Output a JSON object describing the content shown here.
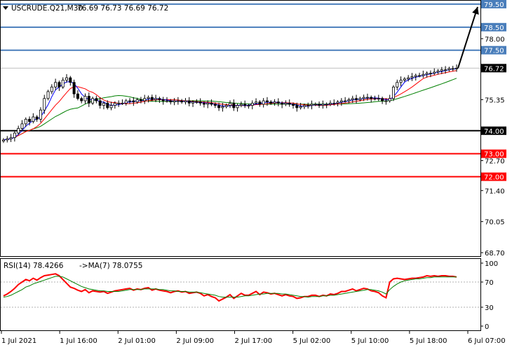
{
  "chart_data": [
    {
      "type": "candlestick",
      "header": {
        "symbol_text": "USCRUDE.Q21,M30",
        "ohlc_text": "76.69 76.73 76.69 76.72",
        "arrow_icon": "triangle-down-icon"
      },
      "y_ticks": [
        79.5,
        78.5,
        78.0,
        77.5,
        76.72,
        75.35,
        74.0,
        73.0,
        72.7,
        72.0,
        71.4,
        70.05,
        68.7
      ],
      "y_tick_labels": [
        "79.50",
        "78.50",
        "78.00",
        "77.50",
        "76.72",
        "75.35",
        "74.00",
        "73.00",
        "72.70",
        "72.00",
        "71.40",
        "70.05",
        "68.70"
      ],
      "ylim": [
        68.55,
        79.65
      ],
      "x_tick_labels": [
        "1 Jul 2021",
        "1 Jul 16:00",
        "2 Jul 01:00",
        "2 Jul 09:00",
        "2 Jul 17:00",
        "5 Jul 02:00",
        "5 Jul 10:00",
        "5 Jul 18:00",
        "6 Jul 07:00"
      ],
      "horizontal_levels": [
        {
          "value": 79.5,
          "label": "79.50",
          "color": "#4a7ebb"
        },
        {
          "value": 78.5,
          "label": "78.50",
          "color": "#4a7ebb"
        },
        {
          "value": 77.5,
          "label": "77.50",
          "color": "#4a7ebb"
        },
        {
          "value": 74.0,
          "label": "74.00",
          "color": "#000000"
        },
        {
          "value": 73.0,
          "label": "73.00",
          "color": "#ff0000"
        },
        {
          "value": 72.0,
          "label": "72.00",
          "color": "#ff0000"
        }
      ],
      "current_price": {
        "value": 76.72,
        "label": "76.72",
        "color": "#000000"
      },
      "projection_arrow": {
        "from": 76.72,
        "to": 79.5,
        "color": "#000000"
      },
      "close_series": [
        73.6,
        73.65,
        73.7,
        73.9,
        74.1,
        74.3,
        74.5,
        74.4,
        74.6,
        74.5,
        74.9,
        75.4,
        75.7,
        75.9,
        76.1,
        75.9,
        76.2,
        76.3,
        76.1,
        75.6,
        75.4,
        75.3,
        75.5,
        75.2,
        75.4,
        75.3,
        75.1,
        75.2,
        75.0,
        75.1,
        75.2,
        75.2,
        75.2,
        75.3,
        75.3,
        75.25,
        75.35,
        75.3,
        75.4,
        75.45,
        75.35,
        75.4,
        75.35,
        75.3,
        75.3,
        75.25,
        75.3,
        75.3,
        75.25,
        75.3,
        75.2,
        75.25,
        75.25,
        75.2,
        75.15,
        75.2,
        75.15,
        75.1,
        75.0,
        75.05,
        75.1,
        75.2,
        75.0,
        75.1,
        75.15,
        75.1,
        75.1,
        75.2,
        75.25,
        75.15,
        75.3,
        75.25,
        75.2,
        75.25,
        75.2,
        75.15,
        75.2,
        75.15,
        75.1,
        75.0,
        75.05,
        75.1,
        75.1,
        75.15,
        75.15,
        75.1,
        75.15,
        75.15,
        75.2,
        75.2,
        75.25,
        75.3,
        75.3,
        75.35,
        75.4,
        75.35,
        75.4,
        75.45,
        75.45,
        75.4,
        75.4,
        75.4,
        75.3,
        75.3,
        75.4,
        75.9,
        76.1,
        76.2,
        76.25,
        76.3,
        76.35,
        76.4,
        76.4,
        76.45,
        76.5,
        76.5,
        76.55,
        76.6,
        76.65,
        76.65,
        76.7,
        76.7,
        76.72
      ],
      "ma_fast_color": "#0000ff",
      "ma_mid_color": "#ff0000",
      "ma_slow_color": "#008000",
      "up_candle_color": "#ffffff",
      "down_candle_color": "#000000"
    },
    {
      "type": "line",
      "header": {
        "rsi_text": "RSI(14) 78.4266",
        "ma_text": "->MA(7) 78.0755"
      },
      "y_ticks": [
        100,
        70,
        30,
        0
      ],
      "y_tick_labels": [
        "100",
        "70",
        "30",
        "0"
      ],
      "levels": [
        70,
        30
      ],
      "ylim": [
        0,
        100
      ],
      "series": [
        {
          "color": "#ff0000",
          "values": [
            48,
            51,
            55,
            60,
            66,
            70,
            74,
            72,
            76,
            73,
            77,
            80,
            81,
            82,
            83,
            80,
            74,
            68,
            62,
            60,
            57,
            55,
            58,
            53,
            56,
            55,
            54,
            55,
            52,
            54,
            56,
            57,
            58,
            59,
            60,
            57,
            59,
            58,
            60,
            61,
            57,
            59,
            57,
            56,
            55,
            53,
            55,
            56,
            54,
            55,
            52,
            53,
            54,
            52,
            48,
            50,
            47,
            45,
            40,
            43,
            46,
            50,
            44,
            48,
            52,
            49,
            49,
            52,
            55,
            50,
            54,
            53,
            51,
            52,
            50,
            48,
            50,
            48,
            47,
            44,
            45,
            47,
            47,
            49,
            49,
            47,
            49,
            48,
            51,
            50,
            52,
            55,
            55,
            57,
            59,
            56,
            58,
            60,
            59,
            56,
            55,
            53,
            48,
            45,
            70,
            75,
            76,
            75,
            74,
            75,
            76,
            76,
            77,
            78,
            80,
            79,
            80,
            79,
            80,
            80,
            79,
            79,
            78
          ]
        },
        {
          "color": "#008000",
          "values": [
            46,
            47,
            49,
            52,
            55,
            58,
            62,
            64,
            67,
            69,
            71,
            73,
            75,
            77,
            79,
            79,
            78,
            75,
            72,
            69,
            66,
            63,
            61,
            59,
            58,
            57,
            56,
            56,
            55,
            55,
            55,
            55,
            56,
            57,
            58,
            58,
            58,
            58,
            59,
            59,
            59,
            59,
            58,
            58,
            57,
            56,
            56,
            55,
            55,
            55,
            54,
            54,
            54,
            53,
            52,
            51,
            50,
            49,
            47,
            46,
            46,
            46,
            46,
            46,
            47,
            48,
            48,
            49,
            50,
            51,
            51,
            52,
            52,
            52,
            52,
            51,
            51,
            50,
            49,
            48,
            47,
            47,
            46,
            47,
            47,
            47,
            48,
            48,
            49,
            49,
            50,
            51,
            52,
            53,
            54,
            55,
            56,
            57,
            58,
            58,
            57,
            56,
            54,
            51,
            58,
            63,
            67,
            70,
            72,
            73,
            74,
            75,
            75,
            76,
            77,
            77,
            78,
            78,
            78,
            78,
            78,
            78,
            78
          ]
        }
      ]
    }
  ]
}
